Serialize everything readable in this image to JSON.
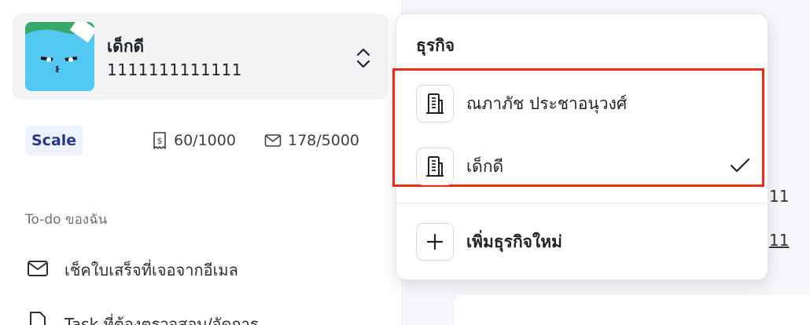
{
  "business_card": {
    "name": "เด็กดี",
    "id": "1111111111111"
  },
  "plan": {
    "badge": "Scale",
    "receipts_quota": "60/1000",
    "emails_quota": "178/5000"
  },
  "todo": {
    "title": "To-do ของฉัน",
    "items": [
      {
        "label": "เช็คใบเสร็จที่เจอจากอีเมล",
        "icon": "mail-icon"
      },
      {
        "label": "Task ที่ต้องตรวจสอบ/จัดการ",
        "icon": "document-icon"
      }
    ]
  },
  "dropdown": {
    "title": "ธุรกิจ",
    "businesses": [
      {
        "label": "ณภาภัช ประชาอนุวงศ์",
        "icon": "building-icon",
        "selected": false
      },
      {
        "label": "เด็กดี",
        "icon": "building-icon",
        "selected": true
      }
    ],
    "add_label": "เพิ่มธุรกิจใหม่"
  },
  "background": {
    "link_1": "11",
    "link_2": "11"
  },
  "colors": {
    "highlight": "#ee2b14",
    "plan_badge_text": "#27378c",
    "plan_badge_bg": "#eef2ff",
    "logo_bg": "#53c8f2"
  }
}
